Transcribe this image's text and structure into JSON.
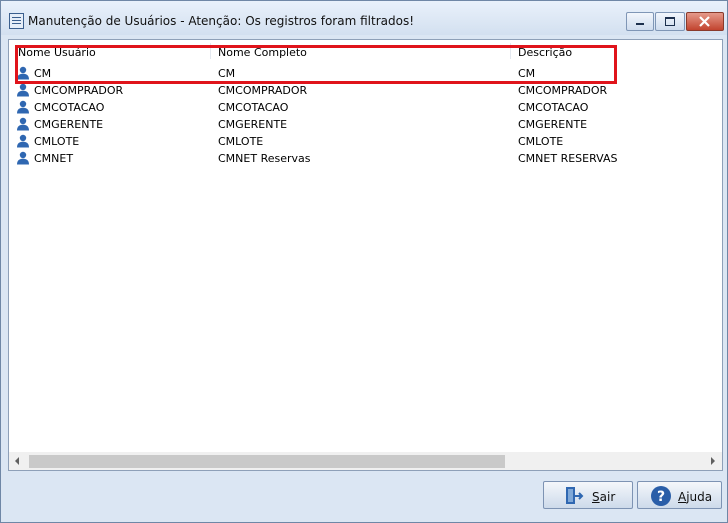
{
  "window": {
    "title": "Manutenção de Usuários - Atenção: Os registros foram filtrados!"
  },
  "list": {
    "columns": [
      "Nome Usuário",
      "Nome Completo",
      "Descrição"
    ],
    "rows": [
      {
        "icon": "user-icon",
        "user": "CM",
        "full": "CM",
        "desc": "CM"
      },
      {
        "icon": "user-icon",
        "user": "CMCOMPRADOR",
        "full": "CMCOMPRADOR",
        "desc": "CMCOMPRADOR"
      },
      {
        "icon": "user-icon",
        "user": "CMCOTACAO",
        "full": "CMCOTACAO",
        "desc": "CMCOTACAO"
      },
      {
        "icon": "user-icon",
        "user": "CMGERENTE",
        "full": "CMGERENTE",
        "desc": "CMGERENTE"
      },
      {
        "icon": "user-icon",
        "user": "CMLOTE",
        "full": "CMLOTE",
        "desc": "CMLOTE"
      },
      {
        "icon": "user-icon",
        "user": "CMNET",
        "full": "CMNET Reservas",
        "desc": "CMNET RESERVAS"
      }
    ]
  },
  "buttons": {
    "sair": {
      "first": "S",
      "rest": "air",
      "icon": "exit-door-icon"
    },
    "ajuda": {
      "first": "A",
      "rest": "juda",
      "icon": "help-icon"
    }
  },
  "colors": {
    "highlight": "#e0141b",
    "user_icon": "#2f67b1",
    "help_icon": "#2a5ea8"
  }
}
